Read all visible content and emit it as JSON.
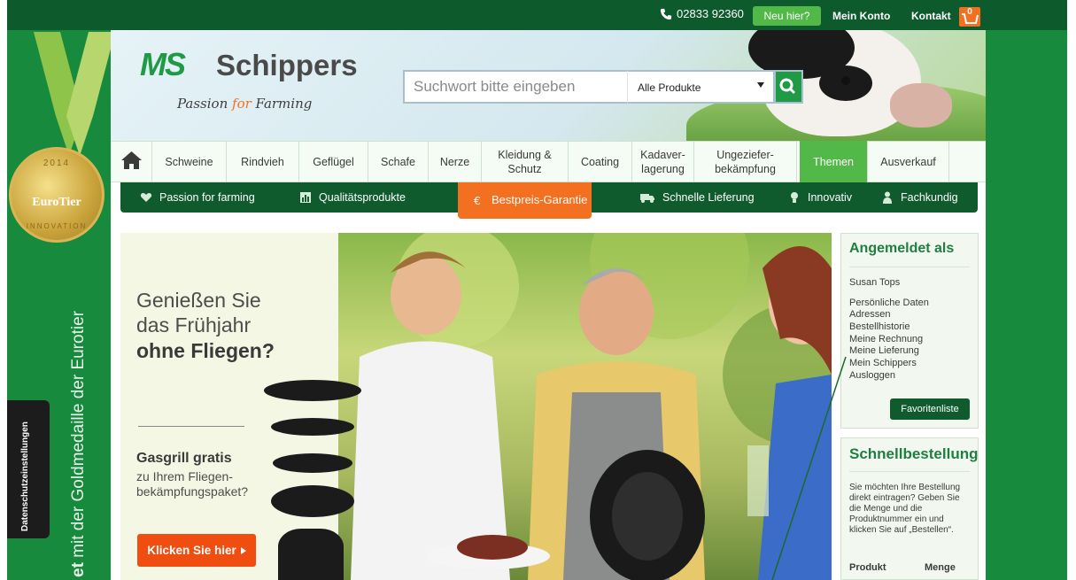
{
  "topbar": {
    "phone": "02833 92360",
    "new_here": "Neu hier?",
    "account": "Mein Konto",
    "contact": "Kontakt",
    "cart_count": "0"
  },
  "left_sidebar": {
    "medal_year": "2014",
    "medal_name": "EuroTier",
    "medal_innovation": "INNOVATION",
    "vertical_prefix": "et",
    "vertical_text": " mit der Goldmedaille der Eurotier",
    "privacy_tab": "Datenschutzeinstellungen"
  },
  "brand": {
    "logo_mark": "MS",
    "logo_name": "Schippers",
    "slogan_a": "Passion ",
    "slogan_for": "for",
    "slogan_b": " Farming"
  },
  "search": {
    "placeholder": "Suchwort bitte eingeben",
    "category": "Alle Produkte"
  },
  "nav": {
    "items": [
      "Schweine",
      "Rindvieh",
      "Geflügel",
      "Schafe",
      "Nerze",
      "Kleidung & Schutz",
      "Coating",
      "Kadaver-lagerung",
      "Ungeziefer-bekämpfung",
      "Themen",
      "Ausverkauf"
    ],
    "active": "Themen"
  },
  "usp": {
    "passion": "Passion for farming",
    "quality": "Qualitätsprodukte",
    "bestprice": "Bestpreis-Garantie",
    "delivery": "Schnelle Lieferung",
    "innovative": "Innovativ",
    "expert": "Fachkundig"
  },
  "hero": {
    "line1": "Genießen Sie",
    "line2": "das Frühjahr",
    "line3": "ohne Fliegen?",
    "sub_bold": "Gasgrill gratis",
    "sub_line1": "zu Ihrem Fliegen-",
    "sub_line2": "bekämpfungspaket?",
    "cta": "Klicken Sie hier"
  },
  "account_box": {
    "title": "Angemeldet als",
    "user": "Susan Tops",
    "links": [
      "Persönliche Daten",
      "Adressen",
      "Bestellhistorie",
      "Meine Rechnung",
      "Meine Lieferung",
      "Mein Schippers",
      "Ausloggen"
    ],
    "favorites": "Favoritenliste"
  },
  "quick_order": {
    "title": "Schnellbestellung",
    "text": "Sie möchten Ihre Bestellung direkt eintragen? Geben Sie die Menge und die Produktnummer ein und klicken Sie auf „Bestellen“.",
    "col_product": "Produkt",
    "col_qty": "Menge"
  },
  "colors": {
    "brand_green": "#1f9a45",
    "dark_green": "#0f5b2d",
    "accent_orange": "#f37021",
    "light_green": "#52b848"
  }
}
